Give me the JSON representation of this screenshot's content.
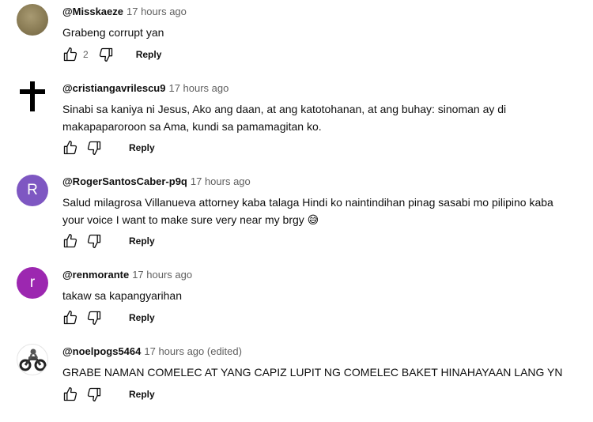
{
  "comments": [
    {
      "author": "@Misskaeze",
      "time": "17 hours ago",
      "text": "Grabeng corrupt yan",
      "likes": "2",
      "reply_label": "Reply",
      "avatar_icon": "profile-photo-avatar"
    },
    {
      "author": "@cristiangavrilescu9",
      "time": "17 hours ago",
      "text": "Sinabi sa kaniya ni Jesus, Ako ang daan, at ang katotohanan, at ang buhay: sinoman ay di makapaparoroon sa Ama, kundi sa pamamagitan ko.",
      "reply_label": "Reply",
      "avatar_icon": "cross-icon"
    },
    {
      "author": "@RogerSantosCaber-p9q",
      "time": "17 hours ago",
      "text": "Salud milagrosa Villanueva attorney kaba talaga Hindi ko naintindihan pinag sasabi mo pilipino kaba your voice I want to make sure very near my brgy 😅",
      "reply_label": "Reply",
      "avatar_letter": "R",
      "avatar_color": "#7e57c2"
    },
    {
      "author": "@renmorante",
      "time": "17 hours ago",
      "text": "takaw sa kapangyarihan",
      "reply_label": "Reply",
      "avatar_letter": "r",
      "avatar_color": "#9c27b0"
    },
    {
      "author": "@noelpogs5464",
      "time": "17 hours ago (edited)",
      "text": "GRABE NAMAN COMELEC AT YANG CAPIZ LUPIT NG COMELEC BAKET HINAHAYAAN LANG YN",
      "reply_label": "Reply",
      "avatar_icon": "motorcycle-photo-avatar"
    }
  ],
  "colors": {
    "author": "#0f0f0f",
    "meta": "#606060",
    "avatar_r": "#7e57c2",
    "avatar_r2": "#9c27b0"
  }
}
